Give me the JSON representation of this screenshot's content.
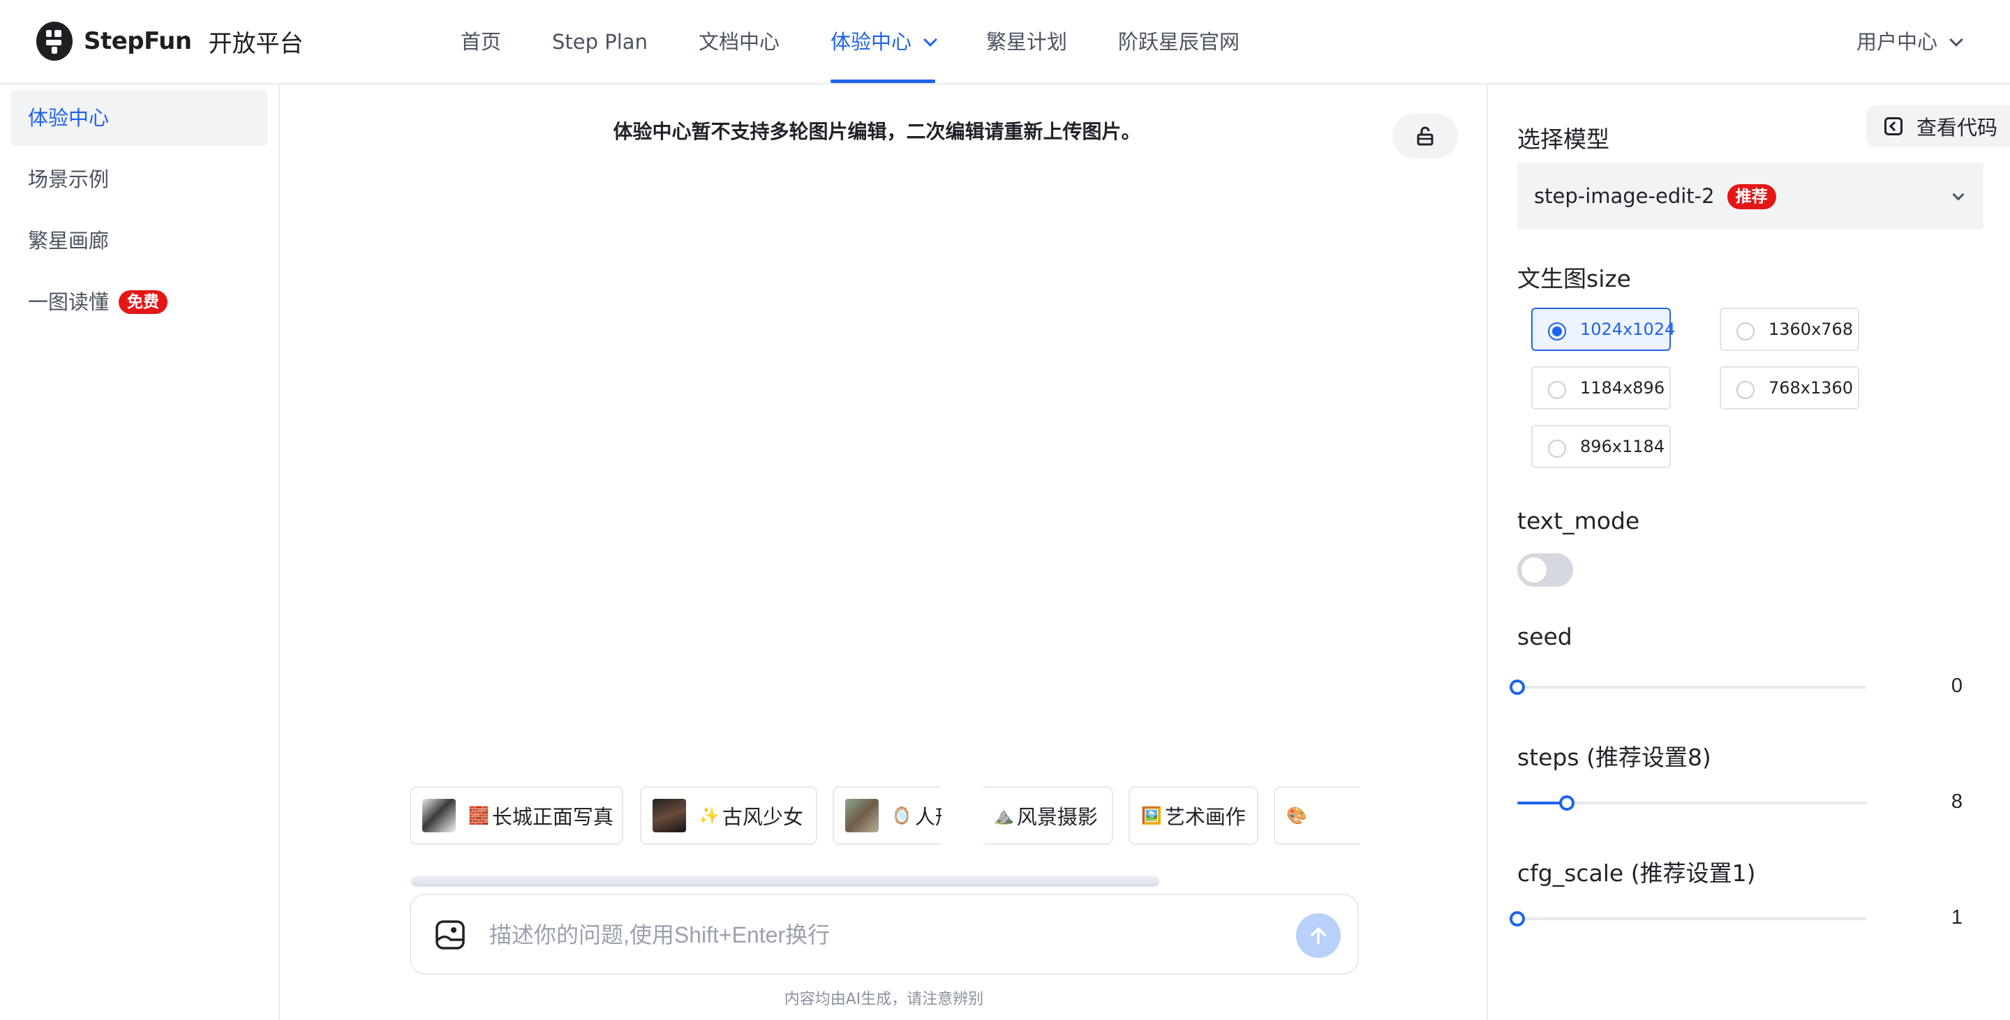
{
  "brand": {
    "name": "StepFun",
    "subtitle": "开放平台"
  },
  "nav": {
    "items": [
      {
        "label": "首页"
      },
      {
        "label": "Step Plan"
      },
      {
        "label": "文档中心"
      },
      {
        "label": "体验中心",
        "active": true,
        "has_dropdown": true
      },
      {
        "label": "繁星计划"
      },
      {
        "label": "阶跃星辰官网"
      }
    ],
    "user_center": "用户中心"
  },
  "sidebar": {
    "items": [
      {
        "label": "体验中心",
        "active": true
      },
      {
        "label": "场景示例"
      },
      {
        "label": "繁星画廊"
      },
      {
        "label": "一图读懂",
        "badge": "免费"
      }
    ]
  },
  "main": {
    "notice": "体验中心暂不支持多轮图片编辑，二次编辑请重新上传图片。",
    "chips": [
      {
        "emoji": "🧱",
        "label": "长城正面写真",
        "has_thumb": true
      },
      {
        "emoji": "✨",
        "label": "古风少女",
        "has_thumb": true
      },
      {
        "emoji": "🪞",
        "label": "人形换装",
        "has_thumb": true
      },
      {
        "emoji": "⛰️",
        "label": "风景摄影",
        "has_thumb": false
      },
      {
        "emoji": "🖼️",
        "label": "艺术画作",
        "has_thumb": false
      },
      {
        "emoji": "🎨",
        "label": "",
        "has_thumb": false
      }
    ],
    "input": {
      "placeholder": "描述你的问题,使用Shift+Enter换行",
      "value": ""
    },
    "disclaimer": "内容均由AI生成，请注意辨别"
  },
  "panel": {
    "view_code": "查看代码",
    "model": {
      "title": "选择模型",
      "value": "step-image-edit-2",
      "tag": "推荐"
    },
    "size": {
      "title": "文生图size",
      "options": [
        "1024x1024",
        "1360x768",
        "1184x896",
        "768x1360",
        "896x1184"
      ],
      "selected": "1024x1024"
    },
    "text_mode": {
      "title": "text_mode",
      "on": false
    },
    "seed": {
      "title": "seed",
      "value": "0",
      "min": 0,
      "max": 100,
      "fraction": 0.0
    },
    "steps": {
      "title": "steps (推荐设置8)",
      "value": "8",
      "fraction": 0.142
    },
    "cfg_scale": {
      "title": "cfg_scale (推荐设置1)",
      "value": "1",
      "fraction": 0.0
    }
  },
  "colors": {
    "accent": "#1f63ea",
    "badge_red": "#e51616",
    "send_disabled": "#b9d0fb"
  }
}
